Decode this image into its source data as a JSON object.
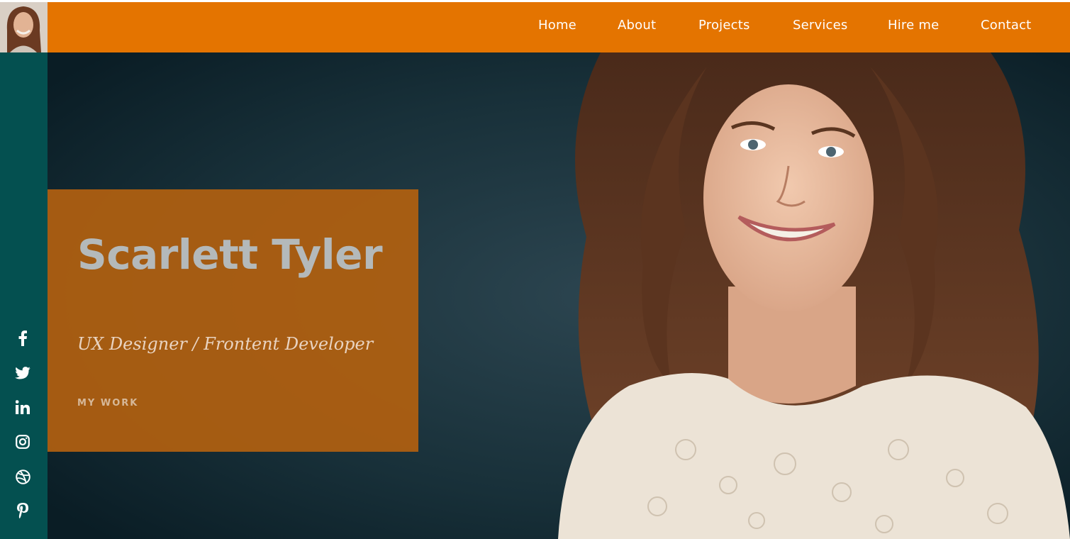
{
  "header": {
    "nav": [
      {
        "label": "Home"
      },
      {
        "label": "About"
      },
      {
        "label": "Projects"
      },
      {
        "label": "Services"
      },
      {
        "label": "Hire me"
      },
      {
        "label": "Contact"
      }
    ]
  },
  "sidebar": {
    "social_icons": [
      "facebook-icon",
      "twitter-icon",
      "linkedin-icon",
      "instagram-icon",
      "dribbble-icon",
      "pinterest-icon"
    ]
  },
  "hero": {
    "name": "Scarlett Tyler",
    "role": "UX Designer / Frontent Developer",
    "cta": "MY WORK"
  },
  "colors": {
    "topbar": "#e47400",
    "sidebar": "#045050",
    "card": "#b06010",
    "hero_background": "#0e2730"
  }
}
